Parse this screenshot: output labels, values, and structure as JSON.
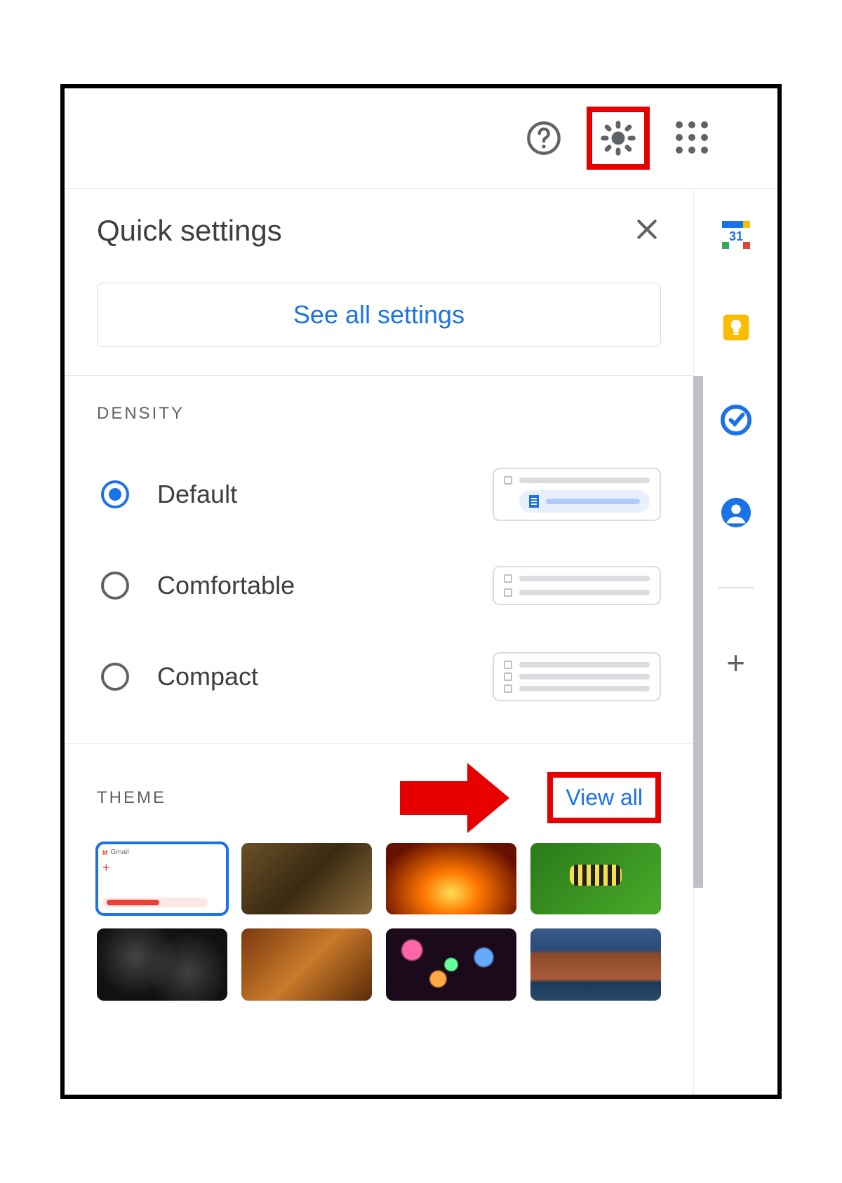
{
  "toolbar": {
    "help_icon": "help-icon",
    "settings_icon": "gear-icon",
    "apps_icon": "apps-grid-icon"
  },
  "quick_settings": {
    "title": "Quick settings",
    "close": "×",
    "all_settings_label": "See all settings"
  },
  "density": {
    "section_label": "DENSITY",
    "options": [
      {
        "label": "Default",
        "selected": true
      },
      {
        "label": "Comfortable",
        "selected": false
      },
      {
        "label": "Compact",
        "selected": false
      }
    ]
  },
  "theme": {
    "section_label": "THEME",
    "view_all_label": "View all",
    "thumbnails": [
      {
        "name": "gmail-default",
        "selected": true
      },
      {
        "name": "chess"
      },
      {
        "name": "canyon-orange"
      },
      {
        "name": "caterpillar-green"
      },
      {
        "name": "dark-spheres"
      },
      {
        "name": "autumn-leaves"
      },
      {
        "name": "bokeh-lights"
      },
      {
        "name": "grand-canyon-river"
      }
    ]
  },
  "side_rail": {
    "items": [
      {
        "name": "calendar-icon",
        "badge": "31"
      },
      {
        "name": "keep-icon"
      },
      {
        "name": "tasks-icon"
      },
      {
        "name": "contacts-icon"
      }
    ],
    "add_label": "+"
  }
}
